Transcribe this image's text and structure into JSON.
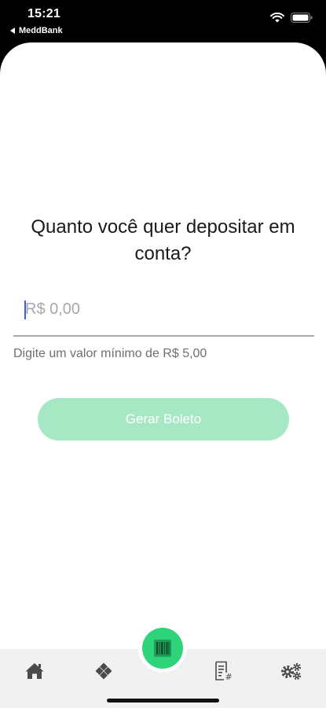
{
  "status_bar": {
    "time": "15:21",
    "back_app": "MeddBank"
  },
  "deposit": {
    "question": "Quanto você quer depositar em conta?",
    "amount_placeholder": "R$ 0,00",
    "hint": "Digite um valor mínimo de R$ 5,00",
    "button_label": "Gerar Boleto"
  },
  "tab_bar": {
    "items": [
      {
        "icon": "home-icon"
      },
      {
        "icon": "diamond-icon"
      },
      {
        "icon": "barcode-icon"
      },
      {
        "icon": "statement-icon"
      },
      {
        "icon": "gears-icon"
      }
    ]
  },
  "colors": {
    "accent": "#2ed47a",
    "button_disabled": "#a6e7c4",
    "caret": "#3d5bf5",
    "tab_icon": "#4a4a4a"
  }
}
